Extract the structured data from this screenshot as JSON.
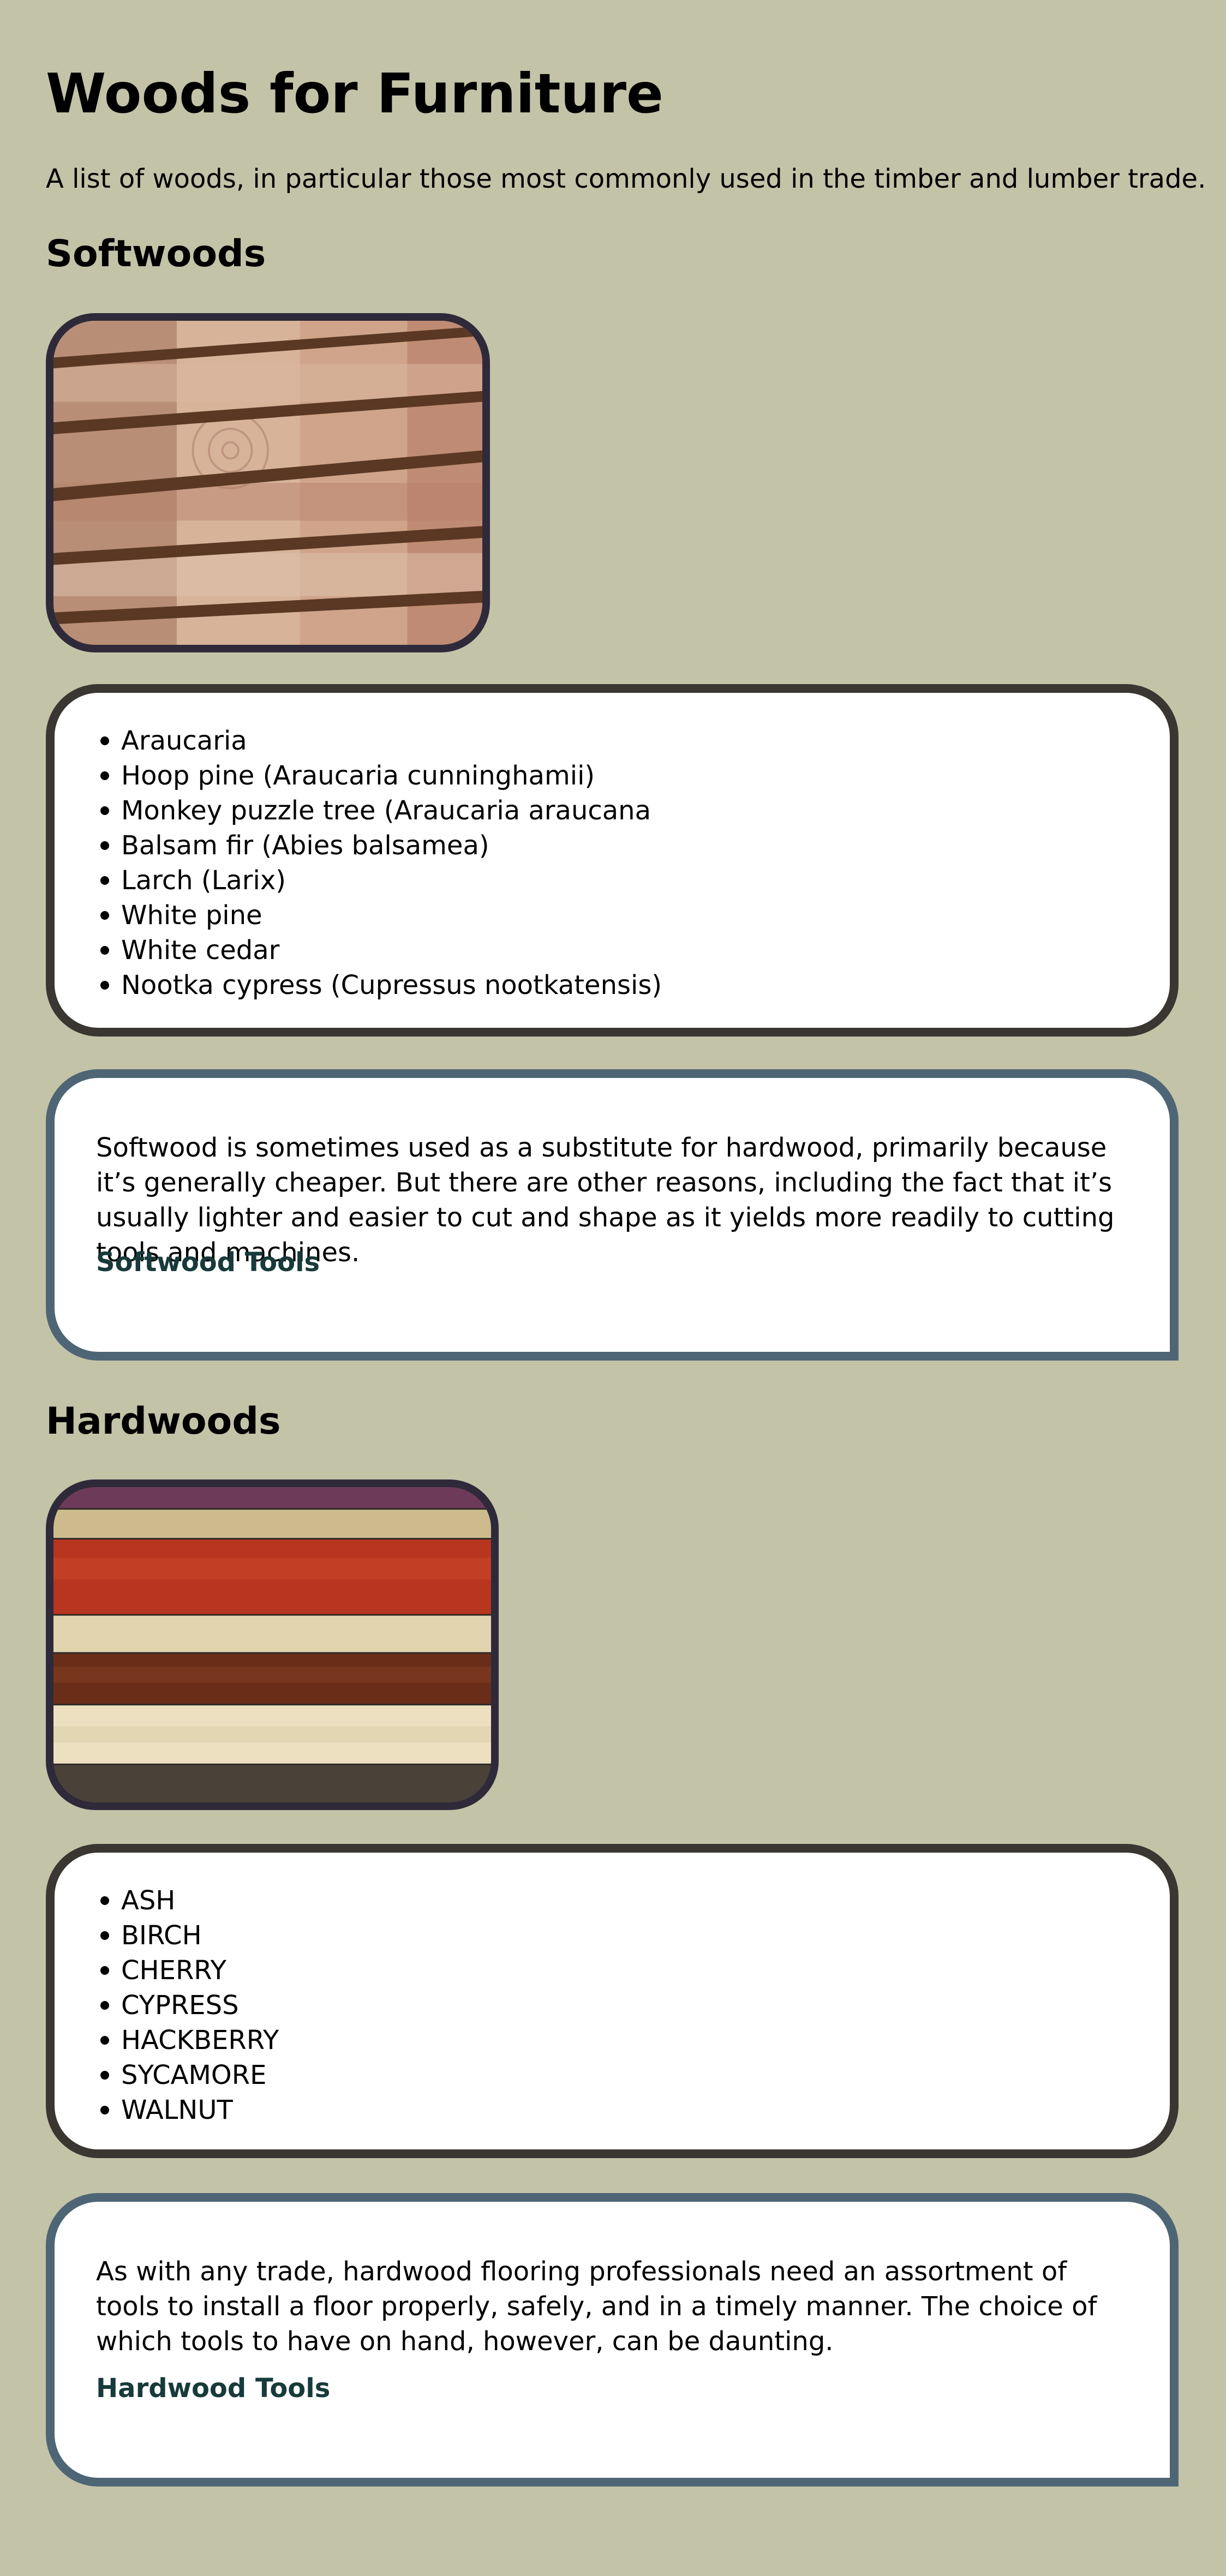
{
  "page": {
    "title": "Woods for Furniture",
    "intro": "A list of woods, in particular those most commonly used in the timber and lumber trade."
  },
  "softwoods": {
    "heading": "Softwoods",
    "image_alt": "Stacked softwood planks",
    "items": [
      "Araucaria",
      "Hoop pine (Araucaria cunninghamii)",
      "Monkey puzzle tree (Araucaria araucana",
      "Balsam fir (Abies balsamea)",
      "Larch (Larix)",
      "White pine",
      "White cedar",
      "Nootka cypress (Cupressus nootkatensis)"
    ],
    "description": "Softwood is sometimes used as a substitute for hardwood, primarily because it’s generally cheaper. But there are other reasons, including the fact that it’s usually lighter and easier to cut and shape as it yields more readily to cutting tools and machines.",
    "link_label": "Softwood Tools"
  },
  "hardwoods": {
    "heading": "Hardwoods",
    "image_alt": "Assorted hardwood boards",
    "items": [
      "ASH",
      "BIRCH",
      "CHERRY",
      "CYPRESS",
      "HACKBERRY",
      "SYCAMORE",
      "WALNUT"
    ],
    "description": "As with any trade, hardwood flooring professionals need an assortment of tools to install a floor properly, safely, and in a timely manner. The choice of which tools to have on hand, however, can be daunting.",
    "link_label": "Hardwood Tools"
  },
  "colors": {
    "page_background": "#c3c3a8",
    "list_border": "#3a3631",
    "text_card_border": "#4e6575",
    "image_frame": "#2e2a3a",
    "link": "#173a3a"
  }
}
